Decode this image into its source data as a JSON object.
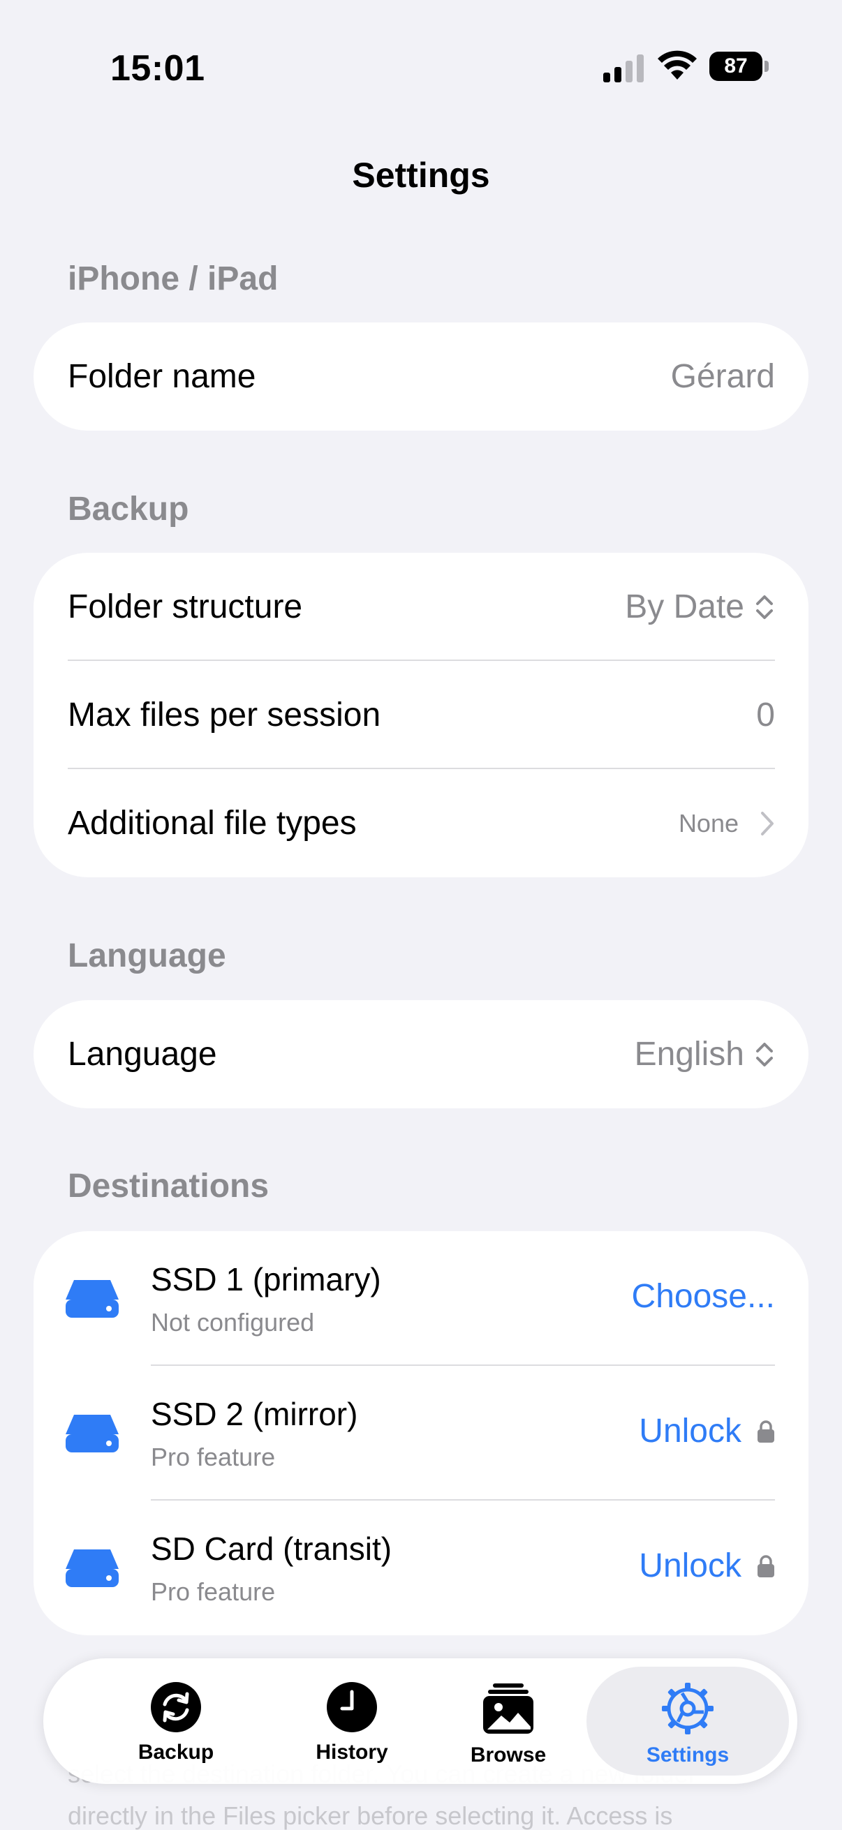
{
  "status_bar": {
    "time": "15:01",
    "battery": "87"
  },
  "nav": {
    "title": "Settings"
  },
  "sections": {
    "device": {
      "header": "iPhone / iPad",
      "folder_name_label": "Folder name",
      "folder_name_value": "Gérard"
    },
    "backup": {
      "header": "Backup",
      "folder_structure_label": "Folder structure",
      "folder_structure_value": "By Date",
      "max_files_label": "Max files per session",
      "max_files_value": "0",
      "file_types_label": "Additional file types",
      "file_types_value": "None"
    },
    "language": {
      "header": "Language",
      "label": "Language",
      "value": "English"
    },
    "destinations": {
      "header": "Destinations",
      "items": [
        {
          "title": "SSD 1 (primary)",
          "subtitle": "Not configured",
          "action": "Choose...",
          "locked": false
        },
        {
          "title": "SSD 2 (mirror)",
          "subtitle": "Pro feature",
          "action": "Unlock",
          "locked": true
        },
        {
          "title": "SD Card (transit)",
          "subtitle": "Pro feature",
          "action": "Unlock",
          "locked": true
        }
      ]
    }
  },
  "background_footer": {
    "line1": "select the destination folder. You can create a new folder",
    "line2": "directly in the Files picker before selecting it. Access is"
  },
  "tab_bar": {
    "tabs": [
      {
        "label": "Backup",
        "icon": "sync-icon"
      },
      {
        "label": "History",
        "icon": "clock-icon"
      },
      {
        "label": "Browse",
        "icon": "photos-icon"
      },
      {
        "label": "Settings",
        "icon": "gear-icon"
      }
    ],
    "active": "Settings"
  },
  "colors": {
    "accent": "#2f7cf6",
    "secondary_text": "#8a8a8e",
    "background": "#f2f2f7"
  }
}
